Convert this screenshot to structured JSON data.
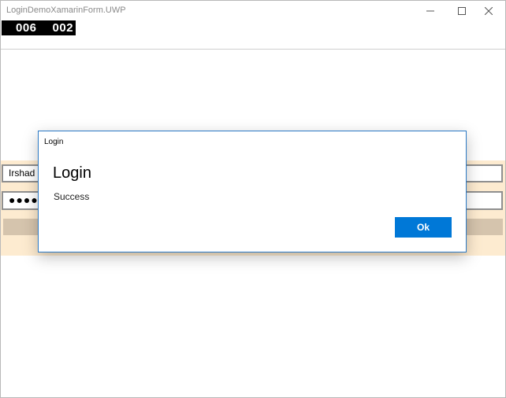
{
  "window": {
    "title": "LoginDemoXamarinForm.UWP"
  },
  "frame_counter": {
    "left_value": "006",
    "right_value": "002"
  },
  "form": {
    "username_value": "Irshad",
    "password_value": "●●●●●●●●●●",
    "band_color": "#fdebd0",
    "button_color": "#d5c4ad"
  },
  "dialog": {
    "caption": "Login",
    "title": "Login",
    "message": "Success",
    "ok_label": "Ok",
    "accent_color": "#0078d7"
  },
  "icons": {
    "minimize": "minimize-icon",
    "maximize": "maximize-icon",
    "close": "close-icon"
  }
}
